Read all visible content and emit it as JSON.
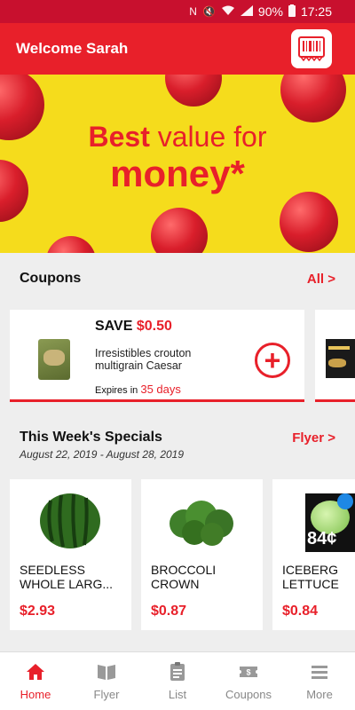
{
  "status": {
    "battery": "90%",
    "time": "17:25"
  },
  "header": {
    "title": "Welcome Sarah"
  },
  "hero": {
    "line1_bold": "Best",
    "line1_rest": " value for",
    "line2": "money*"
  },
  "coupons": {
    "title": "Coupons",
    "link": "All >",
    "card": {
      "save_label": "SAVE",
      "amount": "$0.50",
      "description": "Irresistibles crouton multigrain Caesar",
      "expires_label": "Expires in",
      "expires_days": "35 days"
    }
  },
  "specials": {
    "title": "This Week's Specials",
    "link": "Flyer >",
    "dates": "August 22, 2019 - August 28, 2019",
    "products": [
      {
        "name": "SEEDLESS WHOLE LARG...",
        "price": "$2.93"
      },
      {
        "name": "BROCCOLI CROWN",
        "price": "$0.87"
      },
      {
        "name": "ICEBERG LETTUCE",
        "price": "$0.84"
      }
    ],
    "badge": "84¢"
  },
  "nav": [
    {
      "label": "Home",
      "icon": "home-icon",
      "active": true
    },
    {
      "label": "Flyer",
      "icon": "flyer-icon"
    },
    {
      "label": "List",
      "icon": "list-icon"
    },
    {
      "label": "Coupons",
      "icon": "coupons-icon"
    },
    {
      "label": "More",
      "icon": "menu-icon"
    }
  ],
  "colors": {
    "brand_red": "#e8202a",
    "hero_yellow": "#f5dc1c"
  }
}
